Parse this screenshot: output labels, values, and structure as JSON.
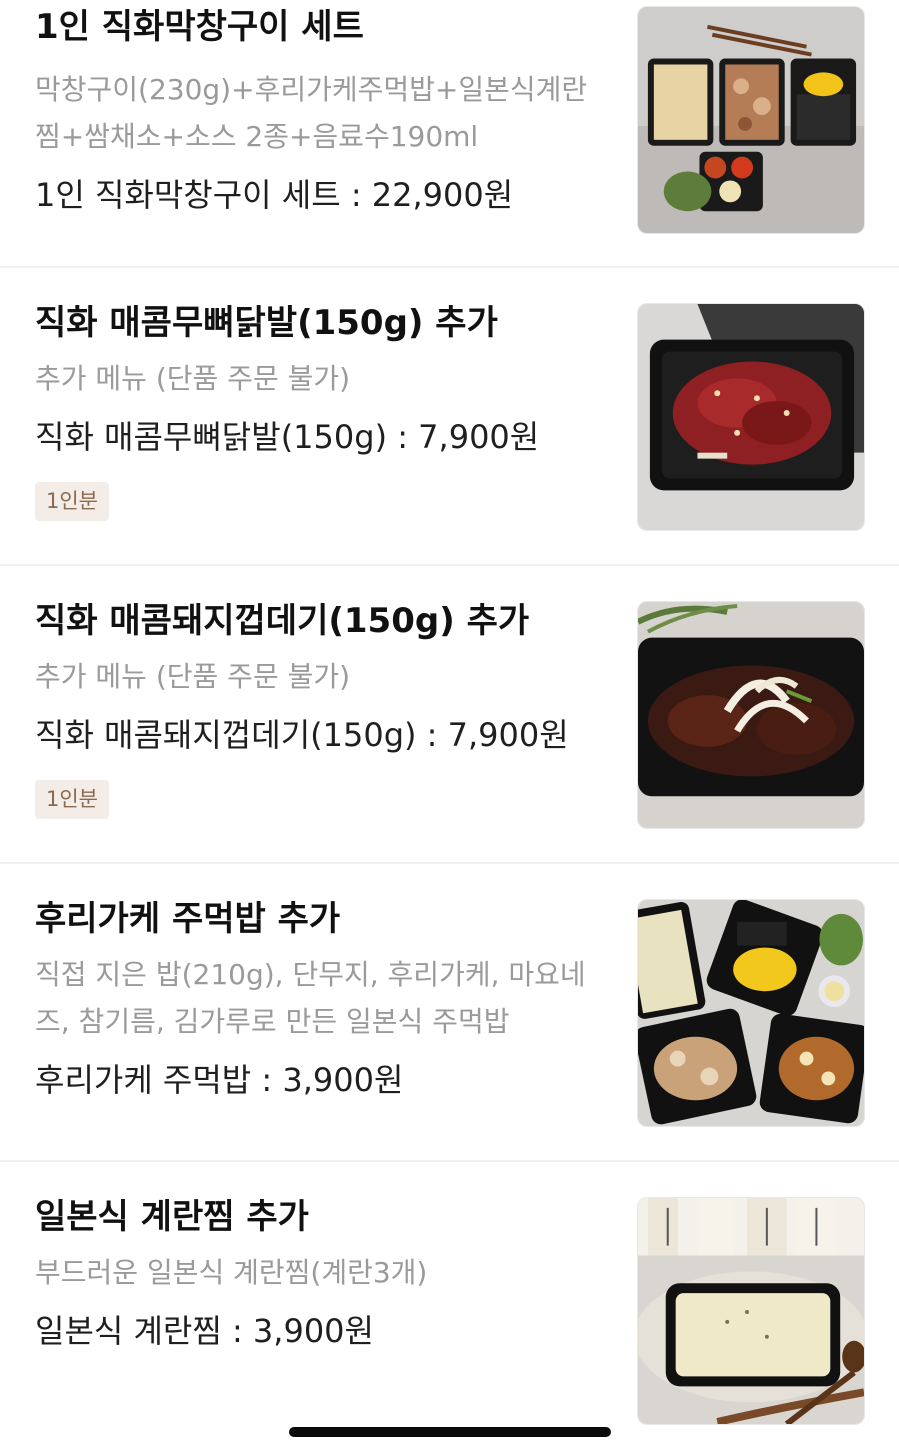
{
  "items": [
    {
      "name": "1인 직화막창구이 세트",
      "description": "막창구이(230g)+후리가케주먹밥+일본식계란찜+쌈채소+소스 2종+음료수190ml",
      "price_line": "1인 직화막창구이 세트 : 22,900원",
      "badge": "",
      "image": "makchang-set-photo"
    },
    {
      "name": "직화 매콤무뼈닭발(150g) 추가",
      "description": "추가 메뉴 (단품 주문 불가)",
      "price_line": "직화 매콤무뼈닭발(150g) : 7,900원",
      "badge": "1인분",
      "image": "spicy-chicken-feet-photo"
    },
    {
      "name": "직화 매콤돼지껍데기(150g) 추가",
      "description": "추가 메뉴 (단품 주문 불가)",
      "price_line": "직화 매콤돼지껍데기(150g) : 7,900원",
      "badge": "1인분",
      "image": "spicy-pork-skin-photo"
    },
    {
      "name": "후리가케 주먹밥 추가",
      "description": "직접 지은 밥(210g), 단무지, 후리가케, 마요네즈, 참기름, 김가루로 만든 일본식 주먹밥",
      "price_line": "후리가케 주먹밥 : 3,900원",
      "badge": "",
      "image": "furikake-rice-ball-photo"
    },
    {
      "name": "일본식 계란찜 추가",
      "description": "부드러운 일본식 계란찜(계란3개)",
      "price_line": "일본식 계란찜 : 3,900원",
      "badge": "",
      "image": "steamed-egg-photo"
    }
  ],
  "colors": {
    "title": "#111111",
    "description": "#9a9a9a",
    "price": "#1f1f1f",
    "badge_text": "#8a6a50",
    "badge_bg": "#f4ece6",
    "divider": "#efefef"
  }
}
